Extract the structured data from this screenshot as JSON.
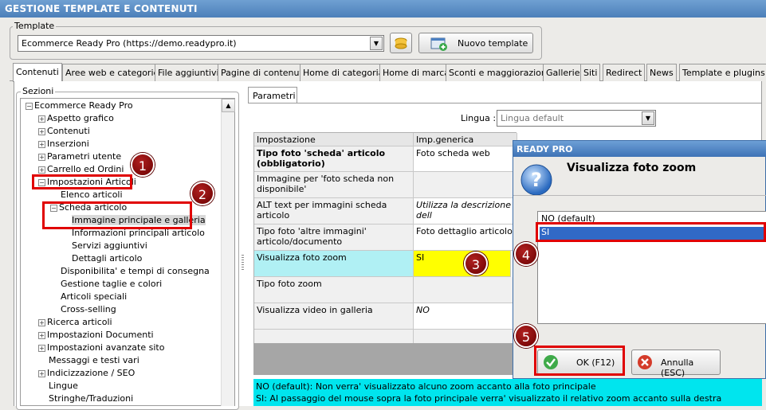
{
  "window": {
    "title": "GESTIONE TEMPLATE E CONTENUTI"
  },
  "template": {
    "group_label": "Template",
    "selected": "Ecommerce Ready Pro (https://demo.readypro.it)",
    "new_button": "Nuovo template"
  },
  "tabs": [
    "Contenuti",
    "Aree web e categorie",
    "File aggiuntivi",
    "Pagine di contenuti",
    "Home di categoria",
    "Home di marca",
    "Sconti e maggiorazioni",
    "Gallerie",
    "Siti",
    "Redirect",
    "News",
    "Template e plugins"
  ],
  "sections": {
    "label": "Sezioni",
    "tree": [
      "Ecommerce Ready Pro",
      "Aspetto grafico",
      "Contenuti",
      "Inserzioni",
      "Parametri utente",
      "Carrello ed Ordini",
      "Impostazioni Articoli",
      "Elenco articoli",
      "Scheda articolo",
      "Immagine principale e galleria",
      "Informazioni principali articolo",
      "Servizi aggiuntivi",
      "Dettagli articolo",
      "Disponibilita' e tempi di consegna",
      "Gestione taglie e colori",
      "Articoli speciali",
      "Cross-selling",
      "Ricerca articoli",
      "Impostazioni Documenti",
      "Impostazioni avanzate sito",
      "Messaggi e testi vari",
      "Indicizzazione / SEO",
      "Lingue",
      "Stringhe/Traduzioni"
    ]
  },
  "params": {
    "tab": "Parametri",
    "language_label": "Lingua :",
    "language_value": "Lingua default",
    "col_setting": "Impostazione",
    "col_value": "Imp.generica",
    "rows": [
      {
        "name": "Tipo foto 'scheda' articolo (obbligatorio)",
        "value": "Foto scheda web"
      },
      {
        "name": "Immagine per 'foto scheda non disponibile'",
        "value": ""
      },
      {
        "name": "ALT text per immagini scheda articolo",
        "value": "Utilizza la descrizione dell"
      },
      {
        "name": "Tipo foto 'altre immagini' articolo/documento",
        "value": "Foto dettaglio articolo"
      },
      {
        "name": "Visualizza foto zoom",
        "value": "SI"
      },
      {
        "name": "Tipo foto zoom",
        "value": ""
      },
      {
        "name": "Visualizza video in galleria",
        "value": "NO"
      }
    ],
    "help_line1": "NO (default): Non verra' visualizzato alcuno zoom accanto alla foto principale",
    "help_line2": "SI: Al passaggio del mouse sopra la foto principale verra' visualizzato il relativo zoom accanto sulla destra"
  },
  "dialog": {
    "title": "READY PRO",
    "heading": "Visualizza foto zoom",
    "options": [
      "NO (default)",
      "SI"
    ],
    "ok": "OK (F12)",
    "cancel": "Annulla (ESC)"
  },
  "badges": [
    "1",
    "2",
    "3",
    "4",
    "5"
  ],
  "colors": {
    "highlight_red": "#e00000",
    "cyan": "#b0f0f4",
    "yellow": "#ffff00",
    "selection": "#3169c6"
  }
}
